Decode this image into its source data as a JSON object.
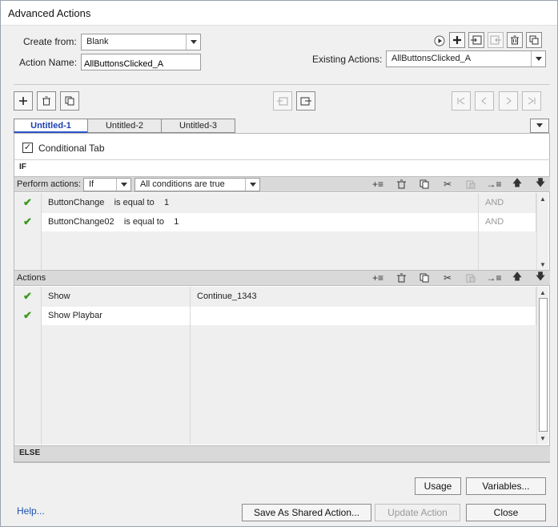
{
  "window": {
    "title": "Advanced Actions"
  },
  "top": {
    "create_from_label": "Create from:",
    "create_from_value": "Blank",
    "action_name_label": "Action Name:",
    "action_name_value": "AllButtonsClicked_A",
    "existing_label": "Existing Actions:",
    "existing_value": "AllButtonsClicked_A"
  },
  "tabs": [
    "Untitled-1",
    "Untitled-2",
    "Untitled-3"
  ],
  "conditional_tab_label": "Conditional Tab",
  "conditional_tab_checked": true,
  "if_label": "IF",
  "condition_bar": {
    "perform_label": "Perform actions:",
    "perform_value": "If",
    "conditions_value": "All conditions are true"
  },
  "conditions": [
    {
      "variable": "ButtonChange",
      "operator": "is equal to",
      "value": "1",
      "logic": "AND"
    },
    {
      "variable": "ButtonChange02",
      "operator": "is equal to",
      "value": "1",
      "logic": "AND"
    }
  ],
  "actions_label": "Actions",
  "actions": [
    {
      "action": "Show",
      "target": "Continue_1343"
    },
    {
      "action": "Show Playbar",
      "target": ""
    }
  ],
  "else_label": "ELSE",
  "buttons": {
    "usage": "Usage",
    "variables": "Variables...",
    "help": "Help...",
    "save_shared": "Save As Shared Action...",
    "update": "Update Action",
    "close": "Close"
  }
}
